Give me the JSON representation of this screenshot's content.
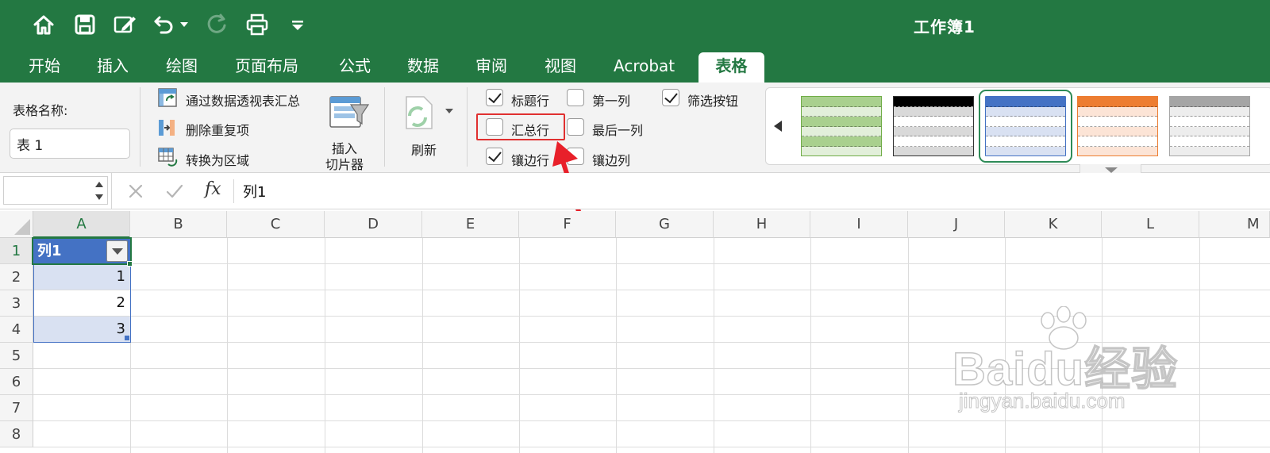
{
  "window": {
    "title": "工作簿1"
  },
  "quick_access": {
    "icons": [
      "home-icon",
      "save-icon",
      "edit-icon",
      "undo-icon",
      "redo-icon",
      "print-icon",
      "customize-icon"
    ]
  },
  "tabs": [
    {
      "label": "开始"
    },
    {
      "label": "插入"
    },
    {
      "label": "绘图"
    },
    {
      "label": "页面布局"
    },
    {
      "label": "公式"
    },
    {
      "label": "数据"
    },
    {
      "label": "审阅"
    },
    {
      "label": "视图"
    },
    {
      "label": "Acrobat"
    },
    {
      "label": "表格",
      "active": true
    }
  ],
  "ribbon": {
    "table_name_label": "表格名称:",
    "table_name_value": "表 1",
    "tools": {
      "pivot": "通过数据透视表汇总",
      "remove_dupes": "删除重复项",
      "convert_range": "转换为区域"
    },
    "insert_slicer_line1": "插入",
    "insert_slicer_line2": "切片器",
    "refresh": "刷新",
    "options": {
      "header_row": {
        "label": "标题行",
        "checked": true
      },
      "total_row": {
        "label": "汇总行",
        "checked": false
      },
      "banded_rows": {
        "label": "镶边行",
        "checked": true
      },
      "first_column": {
        "label": "第一列",
        "checked": false
      },
      "last_column": {
        "label": "最后一列",
        "checked": false
      },
      "banded_columns": {
        "label": "镶边列",
        "checked": false
      },
      "filter_button": {
        "label": "筛选按钮",
        "checked": true
      }
    },
    "styles": [
      {
        "name": "green-style",
        "color": "#a9d08e"
      },
      {
        "name": "dark-style",
        "color": "#000000"
      },
      {
        "name": "blue-style",
        "color": "#4472c4",
        "selected": true
      },
      {
        "name": "orange-style",
        "color": "#ed7d31"
      },
      {
        "name": "gray-style",
        "color": "#a5a5a5"
      }
    ]
  },
  "formula_bar": {
    "name_box_value": "",
    "fx_label": "fx",
    "content": "列1"
  },
  "grid": {
    "columns": [
      "A",
      "B",
      "C",
      "D",
      "E",
      "F",
      "G",
      "H",
      "I",
      "J",
      "K",
      "L",
      "M"
    ],
    "rows": [
      "1",
      "2",
      "3",
      "4",
      "5",
      "6",
      "7",
      "8"
    ],
    "cells": {
      "A1": "列1",
      "A2": "1",
      "A3": "2",
      "A4": "3"
    }
  },
  "watermark": {
    "text": "Baidu经验",
    "sub": "jingyan.baidu.com"
  },
  "colors": {
    "accent": "#237842",
    "table_header": "#4472c4",
    "table_band": "#d9e1f2",
    "highlight": "#e03030"
  }
}
